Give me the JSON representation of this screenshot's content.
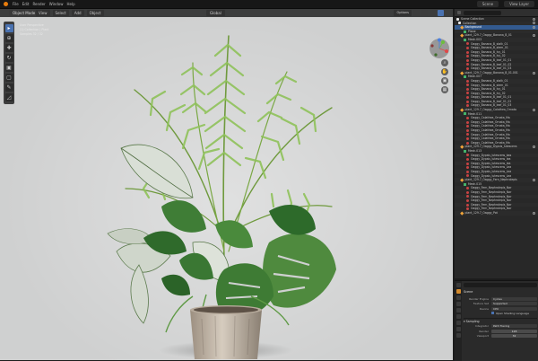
{
  "topbar": {
    "menus": [
      "File",
      "Edit",
      "Render",
      "Window",
      "Help"
    ],
    "scene_label": "Scene",
    "view_layer_label": "View Layer"
  },
  "viewport": {
    "mode": "Object Mode",
    "menus": [
      "View",
      "Select",
      "Add",
      "Object"
    ],
    "transform": "Global",
    "options": "Options",
    "overlay_lines": [
      "User Perspective",
      "(1) Collection | Plant",
      "Samples 32 / 32"
    ]
  },
  "outliner": {
    "rows": [
      {
        "label": "Scene Collection",
        "type": "col",
        "indent": 0
      },
      {
        "label": "Collection",
        "type": "col",
        "indent": 2
      },
      {
        "label": "Background",
        "type": "obj",
        "indent": 5,
        "selected": true
      },
      {
        "label": "Plane",
        "type": "mesh",
        "indent": 8
      },
      {
        "label": "plant_129.7_Oaggy_Banana_B_01",
        "type": "obj",
        "indent": 5
      },
      {
        "label": "Mesh.003",
        "type": "mesh",
        "indent": 8
      },
      {
        "label": "Oaggy_Banana_B_stalk_01",
        "type": "mat",
        "indent": 11
      },
      {
        "label": "Oaggy_Banana_B_stem_01",
        "type": "mat",
        "indent": 11
      },
      {
        "label": "Oaggy_Banana_B_Ivy_01",
        "type": "mat",
        "indent": 11
      },
      {
        "label": "Oaggy_Banana_B_Ivy_02",
        "type": "mat",
        "indent": 11
      },
      {
        "label": "Oaggy_Banana_B_leaf_01_01",
        "type": "mat",
        "indent": 11
      },
      {
        "label": "Oaggy_Banana_B_leaf_01_02",
        "type": "mat",
        "indent": 11
      },
      {
        "label": "Oaggy_Banana_B_leaf_01_03",
        "type": "mat",
        "indent": 11
      },
      {
        "label": "plant_129.7_Oaggy_Banana_B_01.001",
        "type": "obj",
        "indent": 5
      },
      {
        "label": "Mesh.007",
        "type": "mesh",
        "indent": 8
      },
      {
        "label": "Oaggy_Banana_B_stalk_01",
        "type": "mat",
        "indent": 11
      },
      {
        "label": "Oaggy_Banana_B_stem_01",
        "type": "mat",
        "indent": 11
      },
      {
        "label": "Oaggy_Banana_B_Ivy_01",
        "type": "mat",
        "indent": 11
      },
      {
        "label": "Oaggy_Banana_B_Ivy_02",
        "type": "mat",
        "indent": 11
      },
      {
        "label": "Oaggy_Banana_B_leaf_01_01",
        "type": "mat",
        "indent": 11
      },
      {
        "label": "Oaggy_Banana_B_leaf_01_02",
        "type": "mat",
        "indent": 11
      },
      {
        "label": "Oaggy_Banana_B_leaf_01_03",
        "type": "mat",
        "indent": 11
      },
      {
        "label": "plant_129.7_Oaggy_Calathea_Ornata",
        "type": "obj",
        "indent": 5
      },
      {
        "label": "Mesh.011",
        "type": "mesh",
        "indent": 8
      },
      {
        "label": "Oaggy_Calathea_Ornata_Ma",
        "type": "mat",
        "indent": 11
      },
      {
        "label": "Oaggy_Calathea_Ornata_Ma",
        "type": "mat",
        "indent": 11
      },
      {
        "label": "Oaggy_Calathea_Ornata_Ma",
        "type": "mat",
        "indent": 11
      },
      {
        "label": "Oaggy_Calathea_Ornata_Ma",
        "type": "mat",
        "indent": 11
      },
      {
        "label": "Oaggy_Calathea_Ornata_Ma",
        "type": "mat",
        "indent": 11
      },
      {
        "label": "Oaggy_Calathea_Ornata_Ma",
        "type": "mat",
        "indent": 11
      },
      {
        "label": "Oaggy_Calathea_Ornata_Ma",
        "type": "mat",
        "indent": 11
      },
      {
        "label": "plant_129.7_Oaggy_Dypsis_lutescens",
        "type": "obj",
        "indent": 5
      },
      {
        "label": "Mesh.013",
        "type": "mesh",
        "indent": 8
      },
      {
        "label": "Oaggy_Dypsis_lutescens_bas",
        "type": "mat",
        "indent": 11
      },
      {
        "label": "Oaggy_Dypsis_lutescens_lea",
        "type": "mat",
        "indent": 11
      },
      {
        "label": "Oaggy_Dypsis_lutescens_lea",
        "type": "mat",
        "indent": 11
      },
      {
        "label": "Oaggy_Dypsis_lutescens_Lea",
        "type": "mat",
        "indent": 11
      },
      {
        "label": "Oaggy_Dypsis_lutescens_Lea",
        "type": "mat",
        "indent": 11
      },
      {
        "label": "Oaggy_Dypsis_lutescens_Lea",
        "type": "mat",
        "indent": 11
      },
      {
        "label": "plant_129.7_Oaggy_Fern_Nephrolepis",
        "type": "obj",
        "indent": 5
      },
      {
        "label": "Mesh.015",
        "type": "mesh",
        "indent": 8
      },
      {
        "label": "Oaggy_Fern_Nephrolepis_Nar",
        "type": "mat",
        "indent": 11
      },
      {
        "label": "Oaggy_Fern_Nephrolepis_Nar",
        "type": "mat",
        "indent": 11
      },
      {
        "label": "Oaggy_Fern_Nephrolepis_Nar",
        "type": "mat",
        "indent": 11
      },
      {
        "label": "Oaggy_Fern_Nephrolepis_Nar",
        "type": "mat",
        "indent": 11
      },
      {
        "label": "Oaggy_Fern_Nephrolepis_Nar",
        "type": "mat",
        "indent": 11
      },
      {
        "label": "Oaggy_Fern_Nephrolepis_Nar",
        "type": "mat",
        "indent": 11
      },
      {
        "label": "plant_129.7_Oaggy_Pot",
        "type": "obj",
        "indent": 5
      }
    ]
  },
  "properties": {
    "title": "Scene",
    "rows": [
      {
        "label": "Render Engine",
        "value": "Cycles"
      },
      {
        "label": "Feature Set",
        "value": "Supported"
      },
      {
        "label": "Device",
        "value": "CPU"
      }
    ],
    "osl_label": "Open Shading Language",
    "sampling_label": "Sampling",
    "integrator_label": "Integrator",
    "integrator_value": "Path Tracing",
    "render_label": "Render",
    "render_value": "128",
    "viewport_label": "Viewport",
    "viewport_value": "32"
  },
  "colors": {
    "accent": "#4a72b0",
    "selection": "#335a8f",
    "viewport_bg": "#cfd0d0"
  }
}
